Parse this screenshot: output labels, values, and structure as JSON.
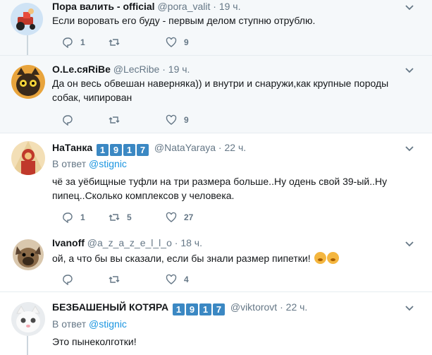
{
  "labels": {
    "in_reply_to": "В ответ"
  },
  "colors": {
    "link": "#1b95e0",
    "muted": "#657786",
    "badge": "#3b88c3",
    "thread_line": "#ccd6dd"
  },
  "tweets": [
    {
      "name": "Пора валить - official",
      "handle": "@pora_valit",
      "time": "19 ч.",
      "text": "Если воровать его буду - первым делом ступню отрублю.",
      "replies": "1",
      "retweets": "",
      "likes": "9"
    },
    {
      "name": "O.Le.сяRiBe",
      "handle": "@LecRibe",
      "time": "19 ч.",
      "text": "Да он весь обвешан наверняка))  и внутри и снаружи,как крупные породы собак, чипирован",
      "replies": "",
      "retweets": "",
      "likes": "9"
    },
    {
      "name": "НаТанка",
      "badges": [
        "1",
        "9",
        "1",
        "7"
      ],
      "handle": "@NataYaraya",
      "time": "22 ч.",
      "reply_to": "@stignic",
      "text": "чё за уёбищные туфли на три размера больше..Ну одень свой 39-ый..Ну пипец..Сколько комплексов у человека.",
      "replies": "1",
      "retweets": "5",
      "likes": "27"
    },
    {
      "name": "Ivanoff",
      "handle": "@a_z_a_z_e_l_l_o",
      "time": "18 ч.",
      "text": "ой,  а что бы вы сказали, если бы знали размер пипетки!",
      "emojis": [
        "hushed-face",
        "face-with-hand-over-mouth"
      ],
      "replies": "",
      "retweets": "",
      "likes": "4"
    },
    {
      "name": "БЕЗБАШЕНЫЙ КОТЯРА",
      "badges": [
        "1",
        "9",
        "1",
        "7"
      ],
      "handle": "@viktorovt",
      "time": "22 ч.",
      "reply_to": "@stignic",
      "text": "Это пынеколготки!"
    }
  ]
}
